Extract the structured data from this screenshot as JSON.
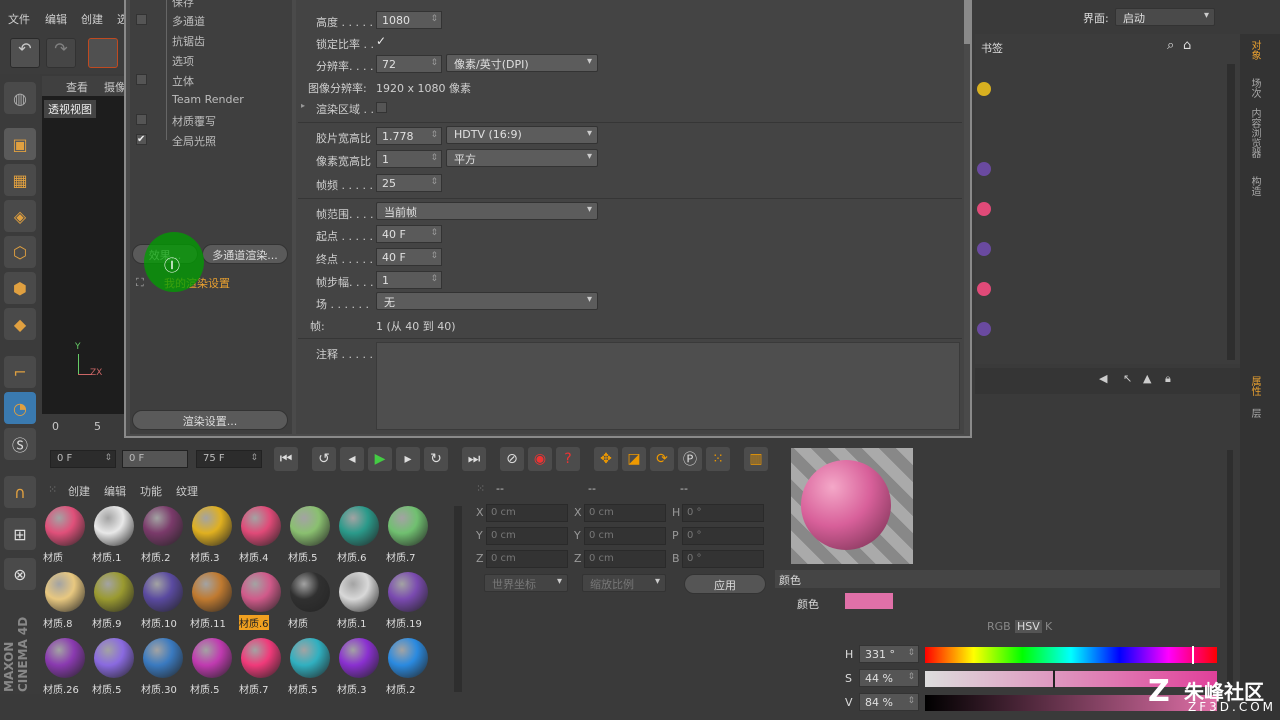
{
  "menu": {
    "file": "文件",
    "edit": "编辑",
    "create": "创建",
    "more": "选"
  },
  "viewport": {
    "tabs": [
      "查看",
      "摄像"
    ],
    "title": "透视视图",
    "axis_y": "Y",
    "axis_zx": "ZX"
  },
  "dialog": {
    "tree": [
      "保存",
      "多通道",
      "抗锯齿",
      "选项",
      "立体",
      "Team Render",
      "材质覆写",
      "全局光照"
    ],
    "effects_button": "效果...",
    "multipass_button": "多通道渲染...",
    "render_setting_item": "我的渲染设置",
    "render_settings_button": "渲染设置...",
    "fields": {
      "height_label": "高度 . . . . .",
      "height_value": "1080",
      "lock_ratio_label": "锁定比率 . .",
      "lock_ratio_check": "✓",
      "resolution_label": "分辨率. . . .",
      "resolution_value": "72",
      "resolution_unit": "像素/英寸(DPI)",
      "image_res_label": "图像分辨率:",
      "image_res_value": "1920 x 1080 像素",
      "render_region_label": "渲染区域 . .",
      "film_aspect_label": "胶片宽高比",
      "film_aspect_value": "1.778",
      "film_aspect_preset": "HDTV (16:9)",
      "pixel_aspect_label": "像素宽高比",
      "pixel_aspect_value": "1",
      "pixel_aspect_preset": "平方",
      "fps_label": "帧频 . . . . .",
      "fps_value": "25",
      "frame_range_label": "帧范围. . . .",
      "frame_range_value": "当前帧",
      "start_label": "起点 . . . . .",
      "start_value": "40 F",
      "end_label": "终点 . . . . .",
      "end_value": "40 F",
      "step_label": "帧步幅. . . .",
      "step_value": "1",
      "field_label": "场 . . . . . .",
      "field_value": "无",
      "frames_label": "帧:",
      "frames_value": "1 (从 40 到 40)",
      "notes_label": "注释 . . . . ."
    }
  },
  "timeline": {
    "ticks": [
      "0",
      "5"
    ],
    "frame_a": "0 F",
    "frame_b": "0 F",
    "frame_c": "75 F"
  },
  "materials": {
    "menu": [
      "创建",
      "编辑",
      "功能",
      "纹理"
    ],
    "items": [
      {
        "label": "材质",
        "color": "#e0507a"
      },
      {
        "label": "材质.1",
        "color": "#e8e8e8"
      },
      {
        "label": "材质.2",
        "color": "#7a3a6a"
      },
      {
        "label": "材质.3",
        "color": "#e0b020"
      },
      {
        "label": "材质.4",
        "color": "#e04a78"
      },
      {
        "label": "材质.5",
        "color": "#8ac070"
      },
      {
        "label": "材质.6",
        "color": "#2a9a8a"
      },
      {
        "label": "材质.7",
        "color": "#70c070"
      },
      {
        "label": "材质.8",
        "color": "#e8c880"
      },
      {
        "label": "材质.9",
        "color": "#9a9a30"
      },
      {
        "label": "材质.10",
        "color": "#5a4aa0"
      },
      {
        "label": "材质.11",
        "color": "#c07a30"
      },
      {
        "label": "材质.6",
        "color": "#d05a8a"
      },
      {
        "label": "材质",
        "color": "#303030"
      },
      {
        "label": "材质.1",
        "color": "#d8d8d8"
      },
      {
        "label": "材质.19",
        "color": "#7a4ab0"
      },
      {
        "label": "材质.26",
        "color": "#8a3ab0"
      },
      {
        "label": "材质.5",
        "color": "#8a6ae0"
      },
      {
        "label": "材质.30",
        "color": "#3a7ac0"
      },
      {
        "label": "材质.5",
        "color": "#c03ab0"
      },
      {
        "label": "材质.7",
        "color": "#f03a7a"
      },
      {
        "label": "材质.5",
        "color": "#30b0c0"
      },
      {
        "label": "材质.3",
        "color": "#8a30d0"
      },
      {
        "label": "材质.2",
        "color": "#2a8ae0"
      }
    ],
    "selected_index": 12
  },
  "coords": {
    "headers": [
      "--",
      "--",
      "--"
    ],
    "rows": [
      [
        "X",
        "0 cm",
        "X",
        "0 cm",
        "H",
        "0 °"
      ],
      [
        "Y",
        "0 cm",
        "Y",
        "0 cm",
        "P",
        "0 °"
      ],
      [
        "Z",
        "0 cm",
        "Z",
        "0 cm",
        "B",
        "0 °"
      ]
    ],
    "world": "世界坐标",
    "scale": "缩放比例",
    "apply": "应用"
  },
  "objects": {
    "interface_label": "界面:",
    "interface_value": "启动",
    "bookmarks": "书签"
  },
  "attributes": {
    "section": "颜色",
    "color_label": "颜色",
    "swatch": "#e070a8",
    "modes": [
      "RGB",
      "HSV",
      "K"
    ],
    "h_label": "H",
    "h_value": "331 °",
    "s_label": "S",
    "s_value": "44 %",
    "v_label": "V",
    "v_value": "84 %",
    "h_fraction": 0.92,
    "s_fraction": 0.44,
    "v_fraction": 0.84
  },
  "right_tabs": [
    "对象",
    "场次",
    "内容浏览器",
    "构造",
    "属性",
    "层"
  ],
  "brand": "MAXON CINEMA 4D",
  "watermark": {
    "text": "朱峰社区",
    "url": "ZF3D.COM"
  }
}
